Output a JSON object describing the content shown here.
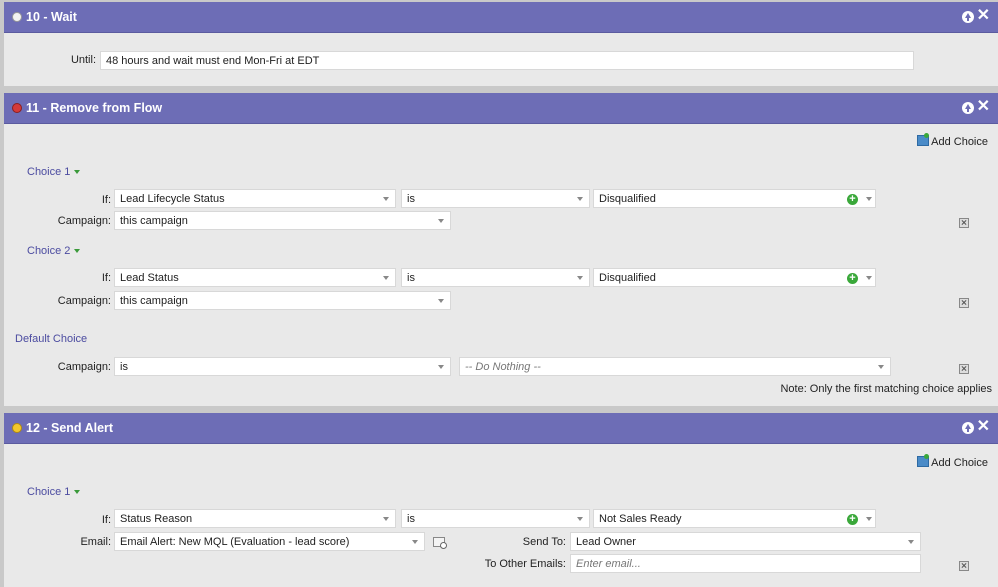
{
  "step10": {
    "title": "10 - Wait",
    "until_label": "Until:",
    "until_value": "48 hours and wait must end Mon-Fri at  EDT"
  },
  "step11": {
    "title": "11 - Remove from Flow",
    "add_choice": "Add Choice",
    "choice1": {
      "label": "Choice 1",
      "if_label": "If:",
      "attribute": "Lead Lifecycle Status",
      "operator": "is",
      "value": "Disqualified",
      "campaign_label": "Campaign:",
      "campaign": "this campaign"
    },
    "choice2": {
      "label": "Choice 2",
      "if_label": "If:",
      "attribute": "Lead Status",
      "operator": "is",
      "value": "Disqualified",
      "campaign_label": "Campaign:",
      "campaign": "this campaign"
    },
    "default": {
      "label": "Default Choice",
      "campaign_label": "Campaign:",
      "operator": "is",
      "value": "-- Do Nothing --"
    },
    "note": "Note: Only the first matching choice applies"
  },
  "step12": {
    "title": "12 - Send Alert",
    "add_choice": "Add Choice",
    "choice1": {
      "label": "Choice 1",
      "if_label": "If:",
      "attribute": "Status Reason",
      "operator": "is",
      "value": "Not Sales Ready",
      "email_label": "Email:",
      "email": "Email Alert: New MQL (Evaluation - lead score)",
      "send_to_label": "Send To:",
      "send_to": "Lead Owner",
      "other_label": "To Other Emails:",
      "other_placeholder": "Enter email..."
    }
  },
  "colors": {
    "header": "#6d6db6",
    "panel": "#e9e9e9",
    "choice_label": "#4b4ba0",
    "plus": "#3aa83a"
  }
}
